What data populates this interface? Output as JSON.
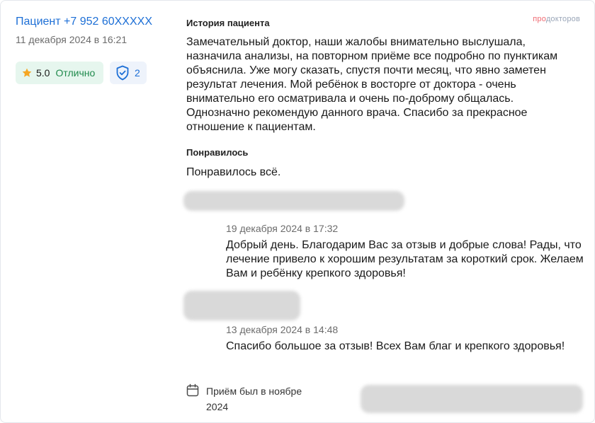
{
  "review": {
    "author": "Пациент +7 952 60XXXXX",
    "date": "11 декабря 2024 в 16:21",
    "rating_value": "5.0",
    "rating_label": "Отлично",
    "verify_count": "2",
    "history_title": "История пациента",
    "history_text": "Замечательный доктор, наши жалобы внимательно выслушала, назначила анализы, на повторном приёме все подробно по пунктикам объяснила. Уже могу сказать, спустя почти месяц, что явно заметен результат лечения. Мой ребёнок в восторге от доктора - очень внимательно его осматривала и очень по-доброму общалась. Однозначно рекомендую данного врача. Спасибо за прекрасное отношение к пациентам.",
    "liked_title": "Понравилось",
    "liked_text": "Понравилось всё."
  },
  "replies": [
    {
      "date": "19 декабря 2024 в 17:32",
      "text": "Добрый день. Благодарим Вас за отзыв и добрые слова! Рады, что лечение привело к хорошим результатам за короткий срок. Желаем Вам и ребёнку крепкого здоровья!"
    },
    {
      "date": "13 декабря 2024 в 14:48",
      "text": "Спасибо большое за отзыв! Всех Вам благ и крепкого здоровья!"
    }
  ],
  "visit": {
    "label": "Приём был в ноябре 2024"
  },
  "brand": {
    "part1": "про",
    "part2": "докторов"
  },
  "colors": {
    "link": "#1d6fd6",
    "rating_bg": "#e6f6ee",
    "rating_text": "#1f8a4c",
    "star": "#f5a623",
    "verify_bg": "#eef3fb"
  },
  "icons": {
    "rating": "star-icon",
    "verify": "shield-check-icon",
    "visit": "calendar-icon"
  }
}
